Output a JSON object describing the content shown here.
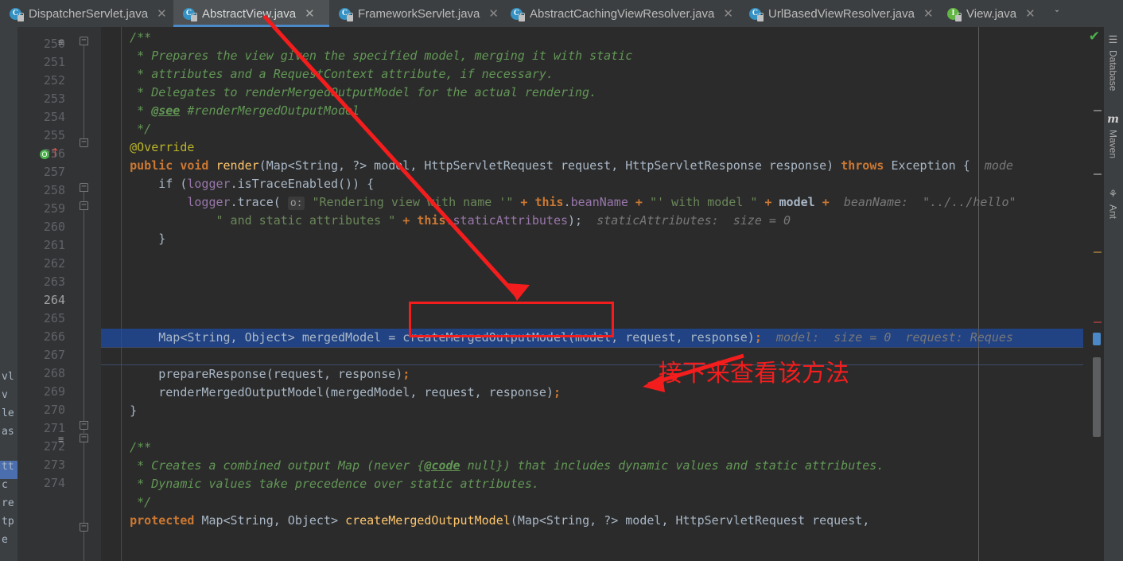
{
  "tabs": [
    {
      "label": "DispatcherServlet.java",
      "icon": "java-class-icon",
      "kind": "class",
      "active": false
    },
    {
      "label": "AbstractView.java",
      "icon": "java-class-icon",
      "kind": "class",
      "active": true
    },
    {
      "label": "FrameworkServlet.java",
      "icon": "java-class-icon",
      "kind": "class",
      "active": false
    },
    {
      "label": "AbstractCachingViewResolver.java",
      "icon": "java-class-icon",
      "kind": "class",
      "active": false
    },
    {
      "label": "UrlBasedViewResolver.java",
      "icon": "java-class-icon",
      "kind": "class",
      "active": false
    },
    {
      "label": "View.java",
      "icon": "java-interface-icon",
      "kind": "interface",
      "active": false
    }
  ],
  "tab_close_glyph": "✕",
  "tab_overflow_glyph": "ˇ",
  "class_icon_letter": "C",
  "interface_icon_letter": "I",
  "editor": {
    "first_line": 250,
    "current_line": 264,
    "highlighted_line": 263,
    "line_numbers": [
      250,
      251,
      252,
      253,
      254,
      255,
      256,
      257,
      258,
      259,
      260,
      261,
      262,
      263,
      264,
      265,
      266,
      267,
      268,
      269,
      270,
      271,
      272,
      273,
      274
    ],
    "lines": [
      {
        "no": 250,
        "text": "    /**"
      },
      {
        "no": 251,
        "text": "     * Prepares the view given the specified model, merging it with static"
      },
      {
        "no": 252,
        "text": "     * attributes and a RequestContext attribute, if necessary."
      },
      {
        "no": 253,
        "text": "     * Delegates to renderMergedOutputModel for the actual rendering."
      },
      {
        "no": 254,
        "text": "     * @see #renderMergedOutputModel"
      },
      {
        "no": 255,
        "text": "     */"
      },
      {
        "no": 256,
        "text": "    @Override"
      },
      {
        "no": 257,
        "text": "    public void render(Map<String, ?> model, HttpServletRequest request, HttpServletResponse response) throws Exception {"
      },
      {
        "no": 258,
        "text": "        if (logger.isTraceEnabled()) {"
      },
      {
        "no": 259,
        "text": "            logger.trace(\"Rendering view with name '\" + this.beanName + \"' with model \" + model +"
      },
      {
        "no": 260,
        "text": "                \" and static attributes \" + this.staticAttributes);"
      },
      {
        "no": 261,
        "text": "        }"
      },
      {
        "no": 262,
        "text": ""
      },
      {
        "no": 263,
        "text": "        Map<String, Object> mergedModel = createMergedOutputModel(model, request, response);"
      },
      {
        "no": 264,
        "text": ""
      },
      {
        "no": 265,
        "text": "        prepareResponse(request, response);"
      },
      {
        "no": 266,
        "text": "        renderMergedOutputModel(mergedModel, request, response);"
      },
      {
        "no": 267,
        "text": "    }"
      },
      {
        "no": 268,
        "text": ""
      },
      {
        "no": 269,
        "text": "    /**"
      },
      {
        "no": 270,
        "text": "     * Creates a combined output Map (never {@code null}) that includes dynamic values and static attributes."
      },
      {
        "no": 271,
        "text": "     * Dynamic values take precedence over static attributes."
      },
      {
        "no": 272,
        "text": "     */"
      },
      {
        "no": 273,
        "text": "    protected Map<String, Object> createMergedOutputModel(Map<String, ?> model, HttpServletRequest request,"
      },
      {
        "no": 274,
        "text": ""
      }
    ],
    "inlay_hints": {
      "line257_mode": "mode",
      "line259_param": "o:",
      "line259_beanname": "beanName:  \"../../hello\"",
      "line260_static": "staticAttributes:  size = 0",
      "line263_model": "model:  size = 0",
      "line263_request": "request:",
      "line263_request_value": "Reques"
    },
    "gutter": {
      "override_marker_line": 257,
      "override_glyph": "↑",
      "breakpoint_glyph": "O",
      "doc_marker_glyph": "≡"
    }
  },
  "annotations": {
    "red_box_code": "createMergedOutputModel",
    "chinese_note": "接下来查看该方法",
    "arrow_color": "#f41d1d"
  },
  "right_tool_strip": [
    {
      "label": "Database",
      "icon": "database-icon",
      "glyph": "☰"
    },
    {
      "label": "Maven",
      "icon": "maven-icon",
      "glyph": "m"
    },
    {
      "label": "Ant",
      "icon": "ant-icon",
      "glyph": "⚘"
    }
  ],
  "status": {
    "inspection_ok_glyph": "✔",
    "inspection_color": "#4bb14b"
  },
  "left_strip_fragments": [
    "vl",
    "v",
    "le",
    "as",
    "tt",
    "c",
    "re",
    "tp",
    "e"
  ],
  "colors": {
    "editor_bg": "#2b2b2b",
    "gutter_bg": "#313335",
    "chrome_bg": "#3c3f41",
    "tab_active_bg": "#4e5254",
    "tab_underline": "#4a88c7",
    "selection_blue": "#214283",
    "keyword": "#cc7832",
    "comment": "#629755",
    "string": "#6a8759",
    "field": "#9876aa",
    "annotation_yellow": "#bbb529",
    "method": "#ffc66d",
    "text": "#a9b7c6",
    "inlay": "#787878",
    "red": "#f41d1d"
  }
}
